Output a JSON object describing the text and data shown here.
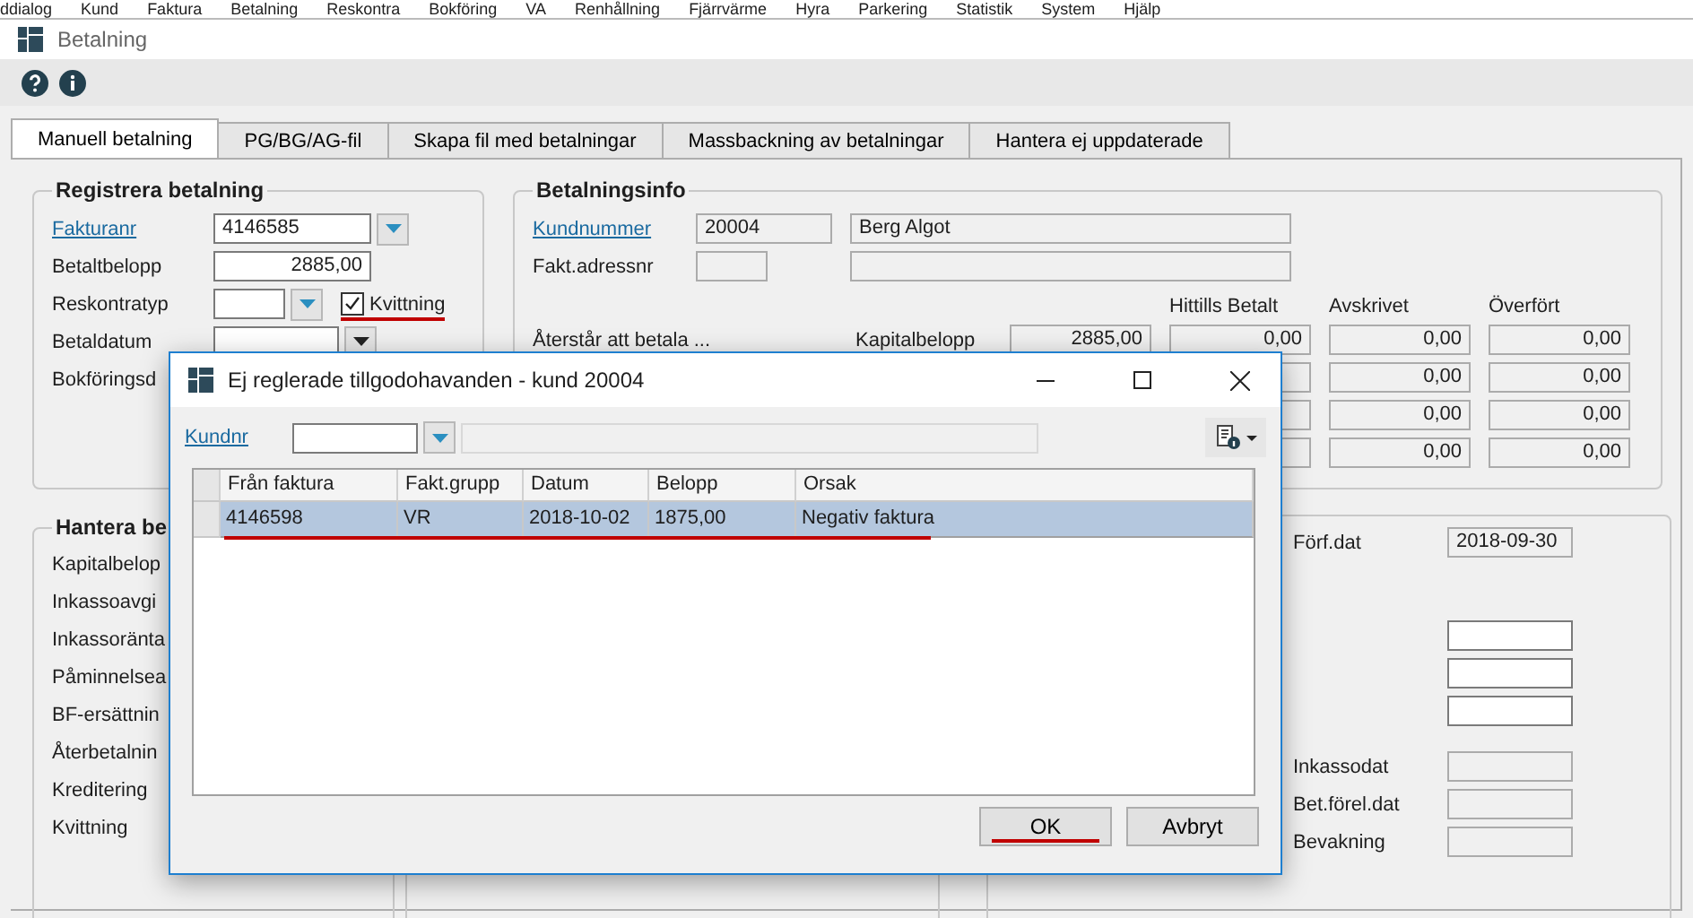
{
  "menu_bar": [
    "ddialog",
    "Kund",
    "Faktura",
    "Betalning",
    "Reskontra",
    "Bokföring",
    "VA",
    "Renhållning",
    "Fjärrvärme",
    "Hyra",
    "Parkering",
    "Statistik",
    "System",
    "Hjälp"
  ],
  "window": {
    "title": "Betalning"
  },
  "tabs": [
    {
      "label": "Manuell betalning",
      "selected": true
    },
    {
      "label": "PG/BG/AG-fil",
      "selected": false
    },
    {
      "label": "Skapa fil med betalningar",
      "selected": false
    },
    {
      "label": "Massbackning av betalningar",
      "selected": false
    },
    {
      "label": "Hantera ej uppdaterade",
      "selected": false
    }
  ],
  "register": {
    "title": "Registrera betalning",
    "fields": [
      {
        "kind": "dropdown",
        "label": "Fakturanr",
        "link": true,
        "value": "4146585"
      },
      {
        "kind": "amount",
        "label": "Betaltbelopp",
        "link": false,
        "value": "2885,00"
      },
      {
        "kind": "dropdown_check",
        "label": "Reskontratyp",
        "link": false,
        "checkbox": {
          "label": "Kvittning",
          "checked": true,
          "marked": true
        }
      },
      {
        "kind": "date",
        "label": "Betaldatum",
        "link": false
      },
      {
        "kind": "label",
        "label": "Bokföringsd",
        "link": false
      }
    ]
  },
  "info": {
    "title": "Betalningsinfo",
    "customer_label": "Kundnummer",
    "customer_number": "20004",
    "customer_name": "Berg Algot",
    "address_label": "Fakt.adressnr",
    "remaining_label": "Återstår att betala ...",
    "columns": [
      "Hittills Betalt",
      "Avskrivet",
      "Överfört"
    ],
    "rows": [
      {
        "label": "Kapitalbelopp",
        "values": [
          "2885,00",
          "0,00",
          "0,00",
          "0,00"
        ]
      },
      {
        "values": [
          "0,00",
          "0,00"
        ]
      },
      {
        "values": [
          "0,00",
          "0,00"
        ]
      },
      {
        "values": [
          "0,00",
          "0,00"
        ]
      }
    ]
  },
  "handle": {
    "title": "Hantera be",
    "labels": [
      "Kapitalbelop",
      "Inkassoavgi",
      "Inkassoränta",
      "Påminnelsea",
      "BF-ersättnin",
      "Återbetalnin",
      "Kreditering",
      "Kvittning"
    ]
  },
  "dates": [
    {
      "kind": "labeled",
      "label": "Förf.dat",
      "value": "2018-09-30"
    },
    {
      "kind": "field"
    },
    {
      "kind": "field"
    },
    {
      "kind": "field"
    },
    {
      "kind": "labeled",
      "label": "Inkassodat"
    },
    {
      "kind": "labeled",
      "label": "Bet.förel.dat"
    },
    {
      "kind": "labeled",
      "label": "Bevakning"
    }
  ],
  "dialog": {
    "title": "Ej reglerade tillgodohavanden - kund 20004",
    "customer_label": "Kundnr",
    "columns": [
      "Från faktura",
      "Fakt.grupp",
      "Datum",
      "Belopp",
      "Orsak"
    ],
    "rows": [
      {
        "cells": [
          "4146598",
          "VR",
          "2018-10-02",
          "1875,00",
          "Negativ faktura"
        ],
        "selected": true,
        "marked": true
      }
    ],
    "buttons": [
      {
        "label": "OK",
        "marked": true
      },
      {
        "label": "Avbryt",
        "marked": false
      }
    ]
  }
}
